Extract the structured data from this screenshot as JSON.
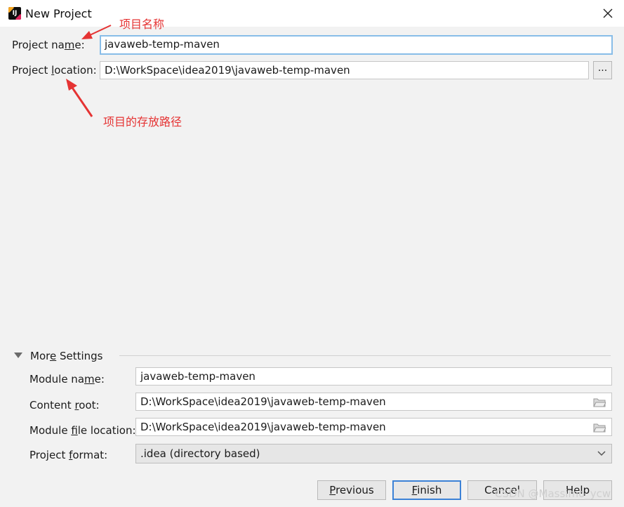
{
  "window": {
    "title": "New Project",
    "icon": "intellij-idea-icon"
  },
  "annotations": {
    "name_note": "项目名称",
    "location_note": "项目的存放路径",
    "arrow_color": "#e53333"
  },
  "project": {
    "name_label_pre": "Project na",
    "name_label_mn": "m",
    "name_label_post": "e:",
    "name_value": "javaweb-temp-maven",
    "location_label_pre": "Project ",
    "location_label_mn": "l",
    "location_label_post": "ocation:",
    "location_value": "D:\\WorkSpace\\idea2019\\javaweb-temp-maven",
    "browse_label": "..."
  },
  "more_settings": {
    "label_pre": "Mor",
    "label_mn": "e",
    "label_post": " Settings",
    "module_name_pre": "Module na",
    "module_name_mn": "m",
    "module_name_post": "e:",
    "module_name_value": "javaweb-temp-maven",
    "content_root_pre": "Content ",
    "content_root_mn": "r",
    "content_root_post": "oot:",
    "content_root_value": "D:\\WorkSpace\\idea2019\\javaweb-temp-maven",
    "module_file_pre": "Module ",
    "module_file_mn": "f",
    "module_file_post": "ile location:",
    "module_file_value": "D:\\WorkSpace\\idea2019\\javaweb-temp-maven",
    "format_pre": "Project ",
    "format_mn": "f",
    "format_post": "ormat:",
    "format_value": ".idea (directory based)"
  },
  "buttons": {
    "previous_mn": "P",
    "previous_post": "revious",
    "finish_mn": "F",
    "finish_post": "inish",
    "cancel": "Cancel",
    "help": "Help"
  },
  "watermark": "CSDN @Massimo_ycw",
  "colors": {
    "accent": "#3c82d6",
    "focus_border": "#88bde8",
    "annotation": "#e53333"
  }
}
